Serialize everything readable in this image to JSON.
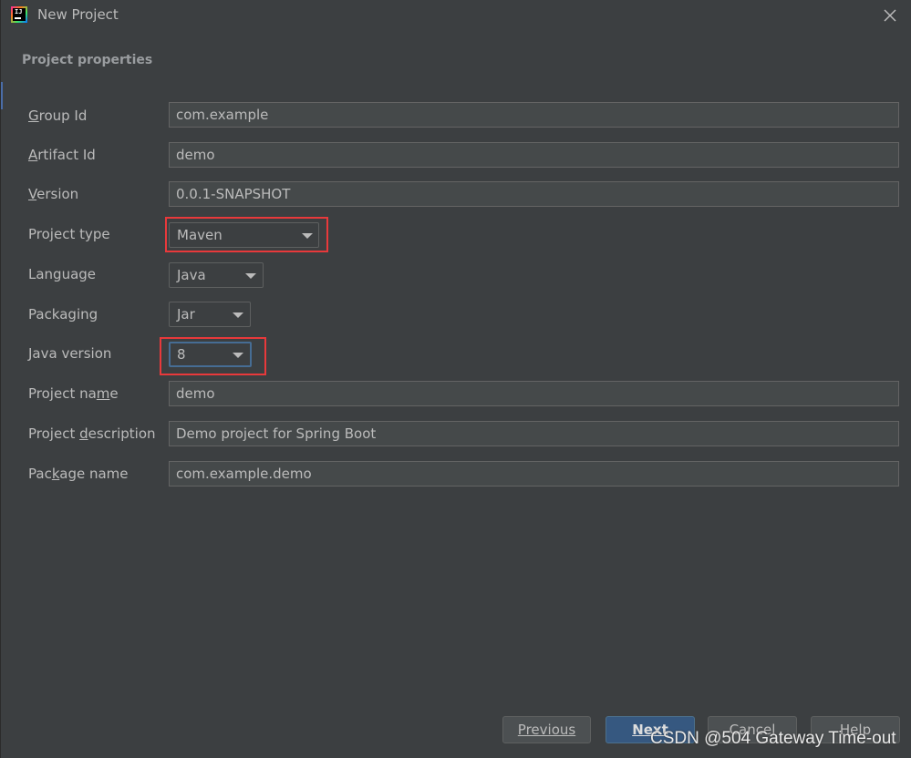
{
  "window": {
    "title": "New Project"
  },
  "section_title": "Project properties",
  "form": {
    "group_id": {
      "label": "Group Id",
      "value": "com.example"
    },
    "artifact_id": {
      "label": "Artifact Id",
      "value": "demo"
    },
    "version": {
      "label": "Version",
      "value": "0.0.1-SNAPSHOT"
    },
    "project_type": {
      "label": "Project type",
      "value": "Maven"
    },
    "language": {
      "label": "Language",
      "value": "Java"
    },
    "packaging": {
      "label": "Packaging",
      "value": "Jar"
    },
    "java_version": {
      "label": "Java version",
      "value": "8"
    },
    "project_name": {
      "label": "Project name",
      "value": "demo"
    },
    "project_description": {
      "label": "Project description",
      "value": "Demo project for Spring Boot"
    },
    "package_name": {
      "label": "Package name",
      "value": "com.example.demo"
    }
  },
  "buttons": {
    "previous": "Previous",
    "next": "Next",
    "cancel": "Cancel",
    "help": "Help"
  },
  "watermark": "CSDN @504 Gateway Time-out",
  "colors": {
    "background": "#3c3f41",
    "field_background": "#45494a",
    "highlight": "#e8393b",
    "primary_button": "#365880",
    "focus_border": "#466d94"
  }
}
